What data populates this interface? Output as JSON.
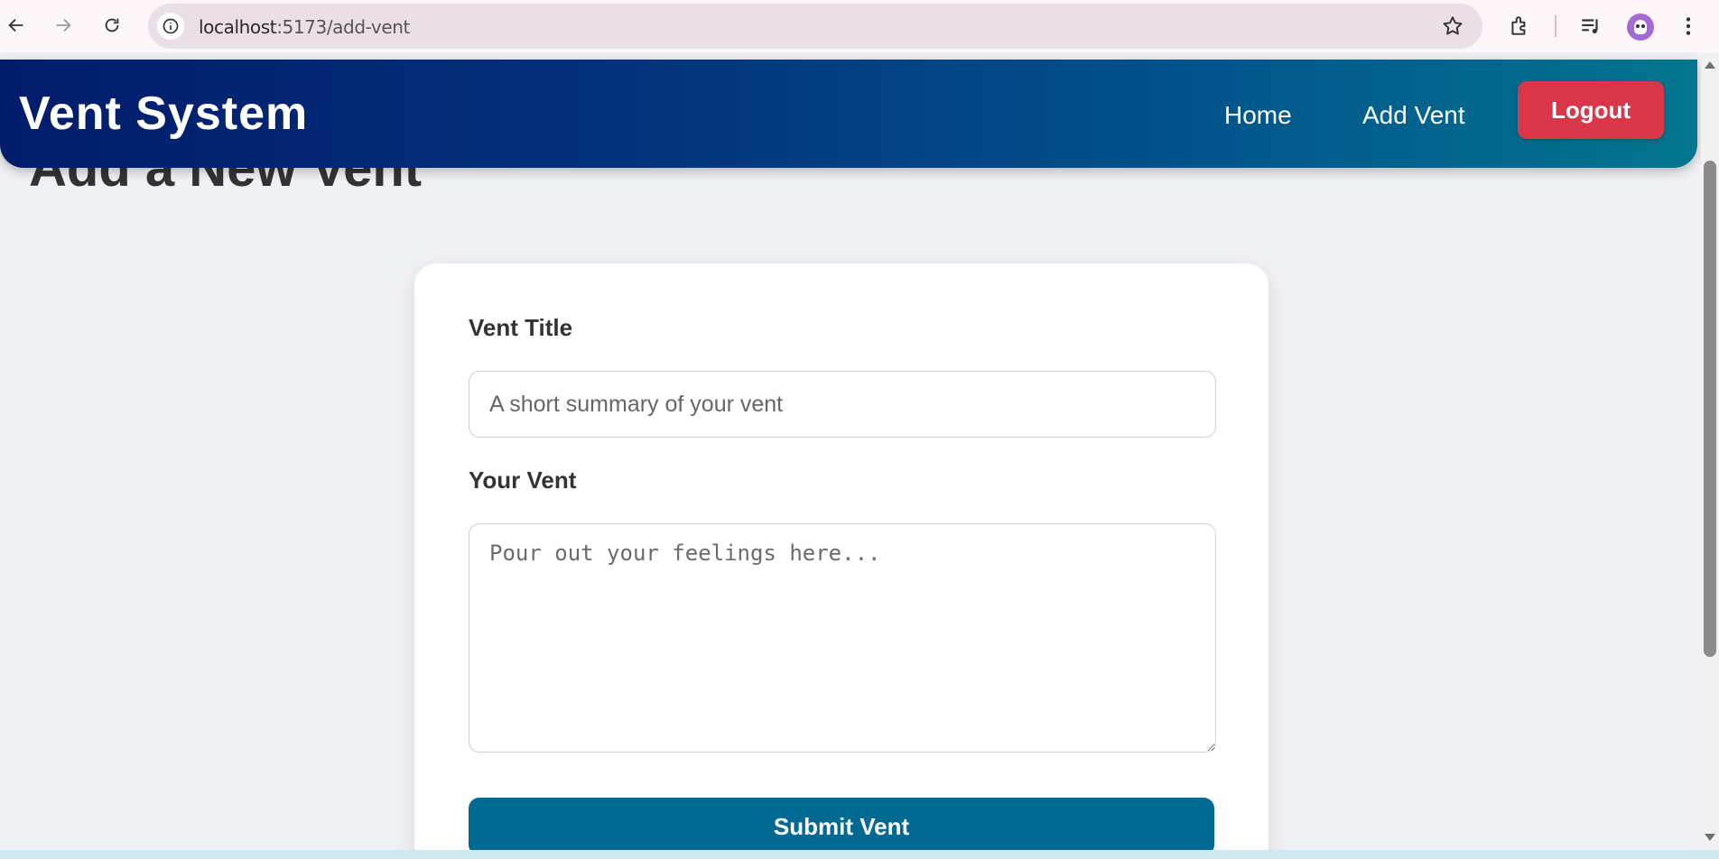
{
  "browser": {
    "url_host": "localhost",
    "url_path": ":5173/add-vent"
  },
  "navbar": {
    "brand": "Vent System",
    "links": [
      {
        "label": "Home"
      },
      {
        "label": "Add Vent"
      }
    ],
    "logout_label": "Logout"
  },
  "page": {
    "title": "Add a New Vent"
  },
  "form": {
    "title_label": "Vent Title",
    "title_placeholder": "A short summary of your vent",
    "title_value": "",
    "vent_label": "Your Vent",
    "vent_placeholder": "Pour out your feelings here...",
    "vent_value": "",
    "submit_label": "Submit Vent"
  },
  "colors": {
    "navbar_gradient_start": "#021c6b",
    "navbar_gradient_end": "#03768f",
    "logout": "#d93649",
    "submit": "#026a92"
  }
}
